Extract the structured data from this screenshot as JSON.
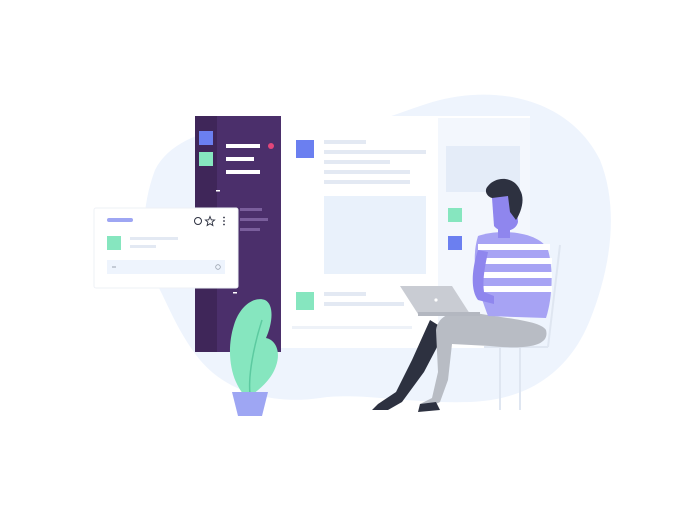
{
  "colors": {
    "blob": "#eef4fd",
    "sidebar": "#4b2f6b",
    "sidebar_dark": "#3f2659",
    "accent_blue": "#6b7ff0",
    "accent_green": "#86e6bf",
    "accent_pink": "#e2467a",
    "panel_line": "#e3e9f3",
    "panel_box": "#e9f1fb",
    "person_skin": "#8f86ee",
    "person_hair": "#2d3140",
    "person_shirt": "#a7a3f4",
    "pants_light": "#b8bcc4",
    "pants_dark": "#2d3140",
    "plant": "#86e6bf",
    "pot": "#9ea6f3",
    "laptop": "#c9ccd3"
  },
  "illustration": {
    "sidebar_icons": [
      "square-blue-icon",
      "square-green-icon"
    ],
    "message_card_icons": [
      "at-icon",
      "star-icon",
      "kebab-icon"
    ],
    "composer_icons": [
      "plus-icon",
      "smiley-icon"
    ]
  }
}
